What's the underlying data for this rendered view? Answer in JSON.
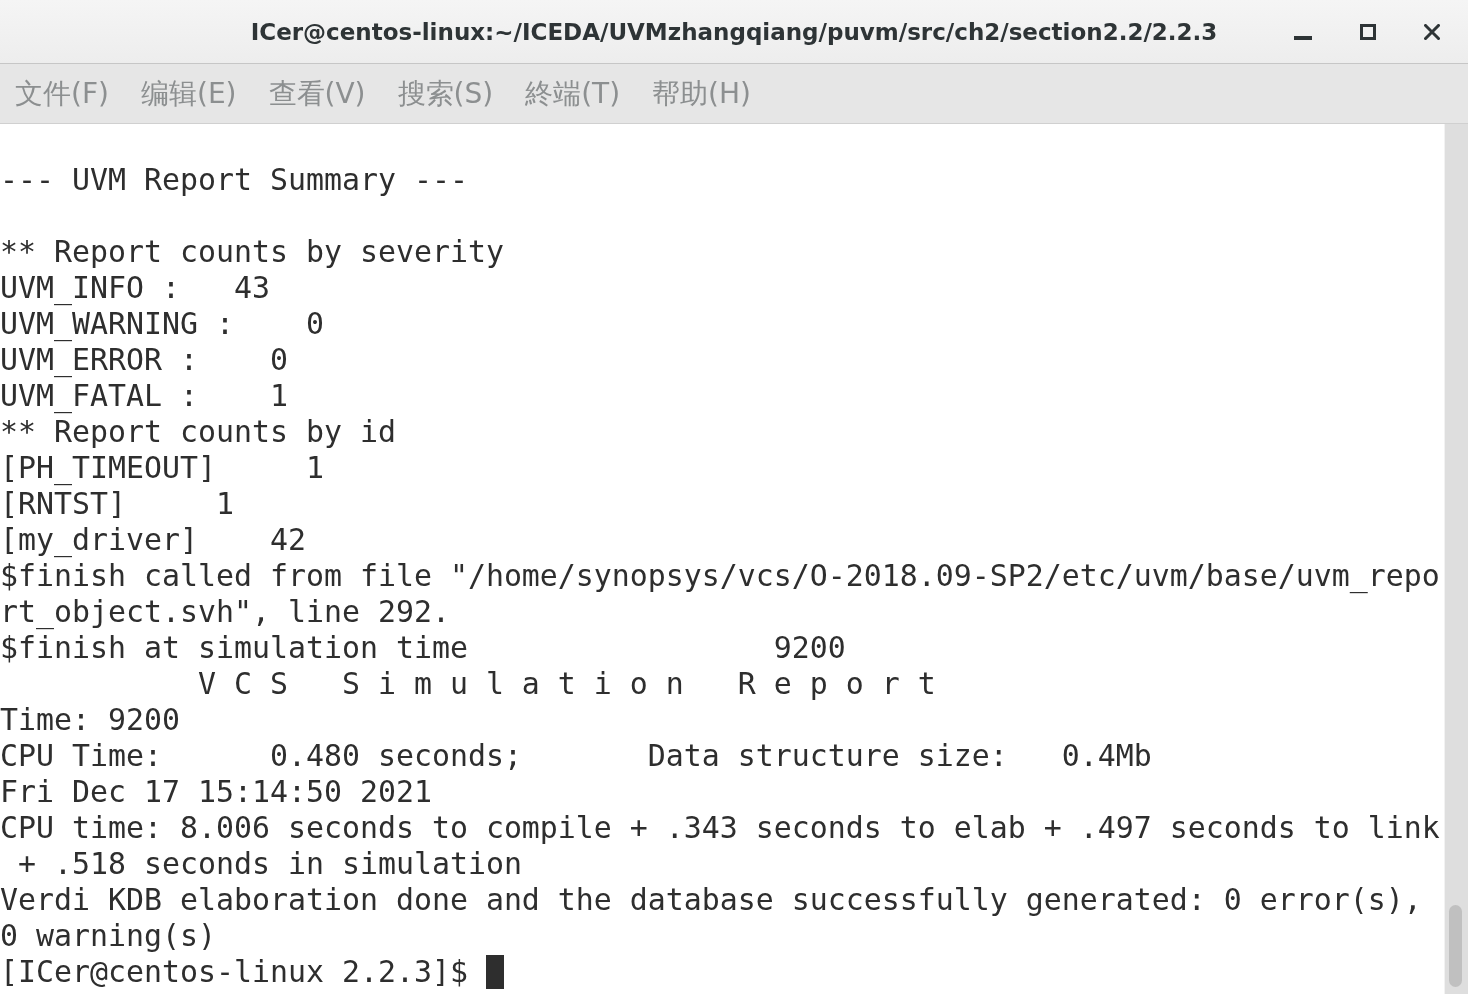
{
  "window": {
    "title": "ICer@centos-linux:~/ICEDA/UVMzhangqiang/puvm/src/ch2/section2.2/2.2.3"
  },
  "menu_bar": [
    "文件(F)",
    "编辑(E)",
    "查看(V)",
    "搜索(S)",
    "終端(T)",
    "帮助(H)"
  ],
  "terminal": {
    "blocks": [
      [
        "--- UVM Report Summary ---"
      ],
      [
        "** Report counts by severity",
        "UVM_INFO :   43",
        "UVM_WARNING :    0",
        "UVM_ERROR :    0",
        "UVM_FATAL :    1",
        "** Report counts by id",
        "[PH_TIMEOUT]     1",
        "[RNTST]     1",
        "[my_driver]    42",
        "$finish called from file \"/home/synopsys/vcs/O-2018.09-SP2/etc/uvm/base/uvm_repo",
        "rt_object.svh\", line 292.",
        "$finish at simulation time                 9200",
        "           V C S   S i m u l a t i o n   R e p o r t",
        "Time: 9200",
        "CPU Time:      0.480 seconds;       Data structure size:   0.4Mb",
        "Fri Dec 17 15:14:50 2021",
        "CPU time: 8.006 seconds to compile + .343 seconds to elab + .497 seconds to link",
        " + .518 seconds in simulation",
        "Verdi KDB elaboration done and the database successfully generated: 0 error(s),",
        "0 warning(s)"
      ]
    ],
    "prompt": "[ICer@centos-linux 2.2.3]$"
  }
}
